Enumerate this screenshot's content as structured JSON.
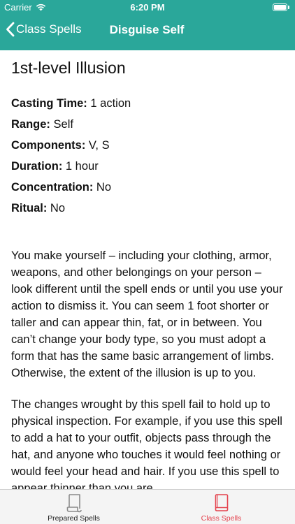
{
  "status_bar": {
    "carrier": "Carrier",
    "time": "6:20 PM",
    "icons": [
      "wifi-icon",
      "battery-icon"
    ]
  },
  "nav": {
    "back_label": "Class Spells",
    "title": "Disguise Self",
    "back_icon": "chevron-left-icon"
  },
  "spell": {
    "level_school": "1st-level Illusion",
    "attributes": [
      {
        "label": "Casting Time:",
        "value": " 1 action"
      },
      {
        "label": "Range:",
        "value": " Self"
      },
      {
        "label": "Components:",
        "value": " V, S"
      },
      {
        "label": "Duration:",
        "value": " 1 hour"
      },
      {
        "label": "Concentration:",
        "value": " No"
      },
      {
        "label": "Ritual:",
        "value": " No"
      }
    ],
    "paragraphs": [
      "You make yourself – including your clothing, armor, weapons, and other belongings on your person – look different until the spell ends or until you use your action to dismiss it. You can seem 1 foot shorter or taller and can appear thin, fat, or in between. You can’t change your body type, so you must adopt a form that has the same basic arrangement of limbs. Otherwise, the extent of the illusion is up to you.",
      "The changes wrought by this spell fail to hold up to physical inspection. For example, if you use this spell to add a hat to your outfit, objects pass through the hat, and anyone who touches it would feel nothing or would feel your head and hair. If you use this spell to appear thinner than you are,"
    ]
  },
  "tabs": [
    {
      "label": "Prepared Spells",
      "icon": "scroll-icon",
      "active": false
    },
    {
      "label": "Class Spells",
      "icon": "book-icon",
      "active": true
    }
  ],
  "colors": {
    "header_bg": "#2aa79a",
    "active_tab": "#e4424d",
    "inactive_tab_icon": "#8a8a8a",
    "tab_bar_bg": "#f4f4f4"
  }
}
